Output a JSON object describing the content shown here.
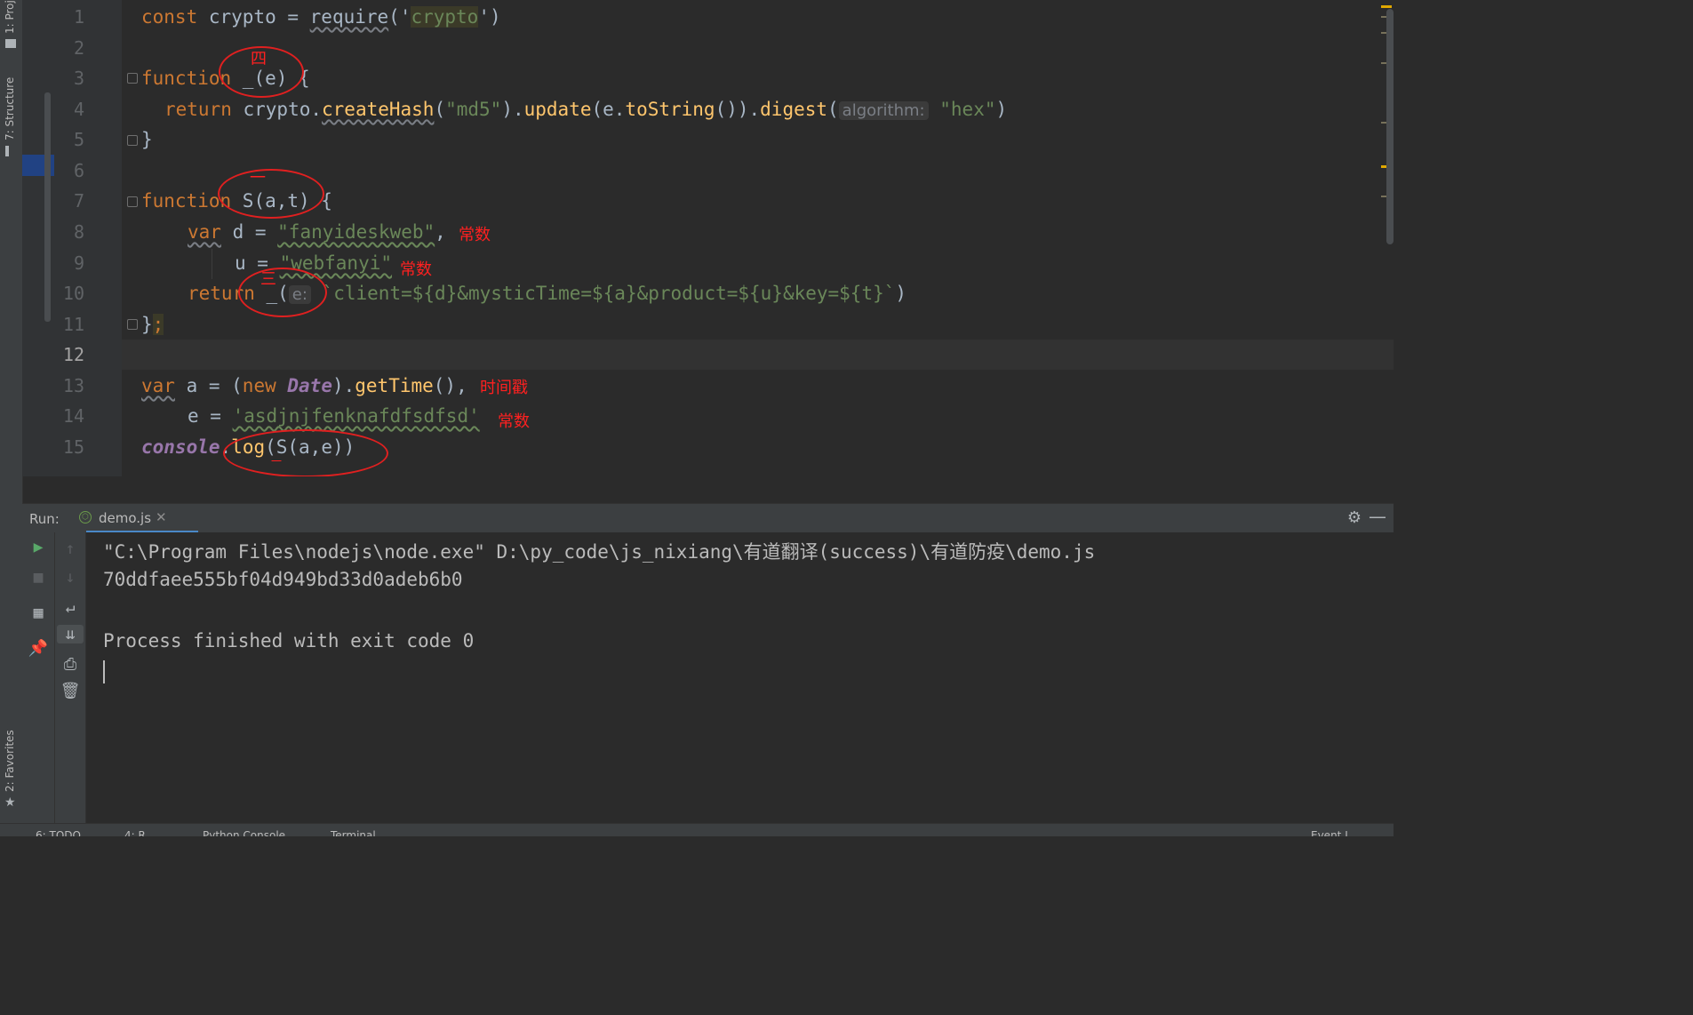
{
  "left_tabs": {
    "project": "1: Proj",
    "structure": "7: Structure",
    "favorites": "2: Favorites"
  },
  "editor": {
    "line_numbers": [
      "1",
      "2",
      "3",
      "4",
      "5",
      "6",
      "7",
      "8",
      "9",
      "10",
      "11",
      "12",
      "13",
      "14",
      "15"
    ],
    "current_line": "12",
    "lines": {
      "l1": {
        "kw": "const",
        "a": " crypto = ",
        "fn": "require",
        "b": "('",
        "s": "crypto",
        "c": "')"
      },
      "l3": {
        "kw": "function",
        "a": " _(e) {"
      },
      "l4": {
        "kw": "return",
        "a": " crypto.",
        "f1": "createHash",
        "b": "(",
        "s1": "\"md5\"",
        "c": ").",
        "f2": "update",
        "d": "(e.",
        "f3": "toString",
        "e": "()).",
        "f4": "digest",
        "g": "(",
        "hint": "algorithm:",
        "s2": "\"hex\"",
        "h": ")"
      },
      "l5": {
        "a": "}"
      },
      "l7": {
        "kw": "function",
        "a": " S(a,t) {"
      },
      "l8": {
        "kw": "var",
        "a": " d = ",
        "s": "\"fanyideskweb\"",
        "c": ","
      },
      "l9": {
        "a": "u = ",
        "s": "\"webfanyi\""
      },
      "l10": {
        "kw": "return",
        "a": " _(",
        "hint": "e:",
        "s": " `client=${d}&mysticTime=${a}&product=${u}&key=${t}`",
        "c": ")"
      },
      "l11": {
        "a": "}",
        "semi": ";"
      },
      "l13": {
        "kw": "var",
        "a": " a = (",
        "kw2": "new",
        "sp": " ",
        "cls": "Date",
        "b": ").",
        "fn": "getTime",
        "c": "(),"
      },
      "l14": {
        "a": "e = ",
        "s": "'asdjnjfenknafdfsdfsd'"
      },
      "l15": {
        "obj": "console",
        "a": ".",
        "fn": "log",
        "b": "(S(a,e))"
      }
    },
    "annotations": {
      "si": "四",
      "yi": "一",
      "san": "三",
      "changshu1": "常数",
      "changshu2": "常数",
      "shijianchuo": "时间戳",
      "changshu3": "常数",
      "yi2": "一"
    }
  },
  "run_panel": {
    "label": "Run:",
    "tab_name": "demo.js",
    "console_lines": [
      "\"C:\\Program Files\\nodejs\\node.exe\" D:\\py_code\\js_nixiang\\有道翻译(success)\\有道防疫\\demo.js",
      "70ddfaee555bf04d949bd33d0adeb6b0",
      "",
      "Process finished with exit code 0"
    ]
  },
  "bottom_bar": {
    "todo": "6: TODO",
    "run": "4: R",
    "python_console": "Python Console",
    "terminal": "Terminal",
    "event_log": "Event L"
  },
  "colors": {
    "keyword": "#cc7832",
    "string": "#6a8759",
    "function": "#ffc66d",
    "annotation_red": "#ff2020",
    "accent_blue": "#4a88c7"
  }
}
